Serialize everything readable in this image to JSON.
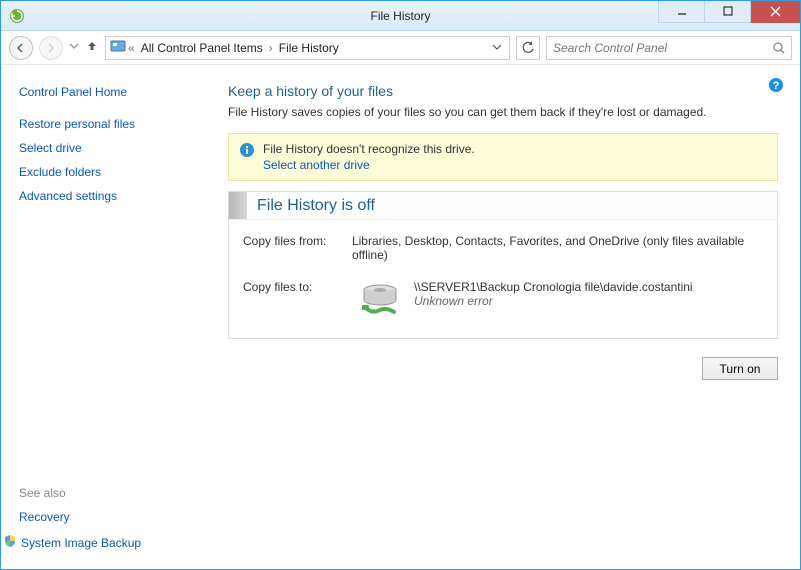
{
  "window": {
    "title": "File History"
  },
  "nav": {
    "breadcrumb_prefix": "«",
    "crumb1": "All Control Panel Items",
    "crumb2": "File History",
    "search_placeholder": "Search Control Panel"
  },
  "sidebar": {
    "heading": "Control Panel Home",
    "links": {
      "restore": "Restore personal files",
      "select_drive": "Select drive",
      "exclude": "Exclude folders",
      "advanced": "Advanced settings"
    },
    "see_also": "See also",
    "recovery": "Recovery",
    "system_image": "System Image Backup"
  },
  "main": {
    "heading": "Keep a history of your files",
    "subtitle": "File History saves copies of your files so you can get them back if they're lost or damaged.",
    "info_message": "File History doesn't recognize this drive.",
    "info_action": "Select another drive",
    "status_title": "File History is off",
    "from_label": "Copy files from:",
    "from_value": "Libraries, Desktop, Contacts, Favorites, and OneDrive (only files available offline)",
    "to_label": "Copy files to:",
    "to_value": "\\\\SERVER1\\Backup Cronologia file\\davide.costantini",
    "to_error": "Unknown error",
    "turn_on": "Turn on"
  }
}
